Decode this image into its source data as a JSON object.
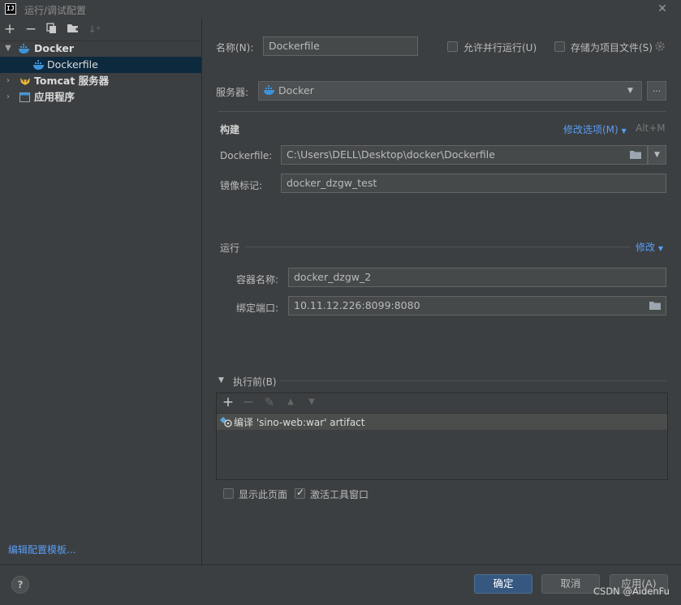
{
  "window": {
    "title": "运行/调试配置",
    "logo_text": "IJ"
  },
  "left": {
    "toolbar": [
      "add-icon",
      "remove-icon",
      "copy-icon",
      "new-folder-icon",
      "sort-icon"
    ],
    "tree": [
      {
        "label": "Docker",
        "expanded": true
      },
      {
        "label": "Dockerfile",
        "selected": true
      },
      {
        "label": "Tomcat 服务器",
        "expanded": false
      },
      {
        "label": "应用程序",
        "expanded": false
      }
    ],
    "edit_templates": "编辑配置模板..."
  },
  "form": {
    "name_label": "名称(N):",
    "name_value": "Dockerfile",
    "allow_parallel": "允许并行运行(U)",
    "store_as_project": "存储为项目文件(S)",
    "server_label": "服务器:",
    "server_value": "Docker",
    "server_more": "...",
    "build": {
      "title": "构建",
      "modify_options": "修改选项(M)",
      "shortcut": "Alt+M",
      "dockerfile_label": "Dockerfile:",
      "dockerfile_value": "C:\\Users\\DELL\\Desktop\\docker\\Dockerfile",
      "image_tag_label": "镜像标记:",
      "image_tag_value": "docker_dzgw_test"
    },
    "run": {
      "title": "运行",
      "modify": "修改",
      "container_label": "容器名称:",
      "container_value": "docker_dzgw_2",
      "bind_ports_label": "绑定端口:",
      "bind_ports_value": "10.11.12.226:8099:8080"
    },
    "before_launch": {
      "title": "执行前(B)",
      "items": [
        "编译 'sino-web:war' artifact"
      ]
    },
    "show_page": {
      "label": "显示此页面",
      "checked": false
    },
    "activate_tool_window": {
      "label": "激活工具窗口",
      "checked": true
    }
  },
  "buttons": {
    "ok": "确定",
    "cancel": "取消",
    "apply": "应用(A)",
    "help": "?"
  },
  "watermark": "CSDN @AidenFu"
}
